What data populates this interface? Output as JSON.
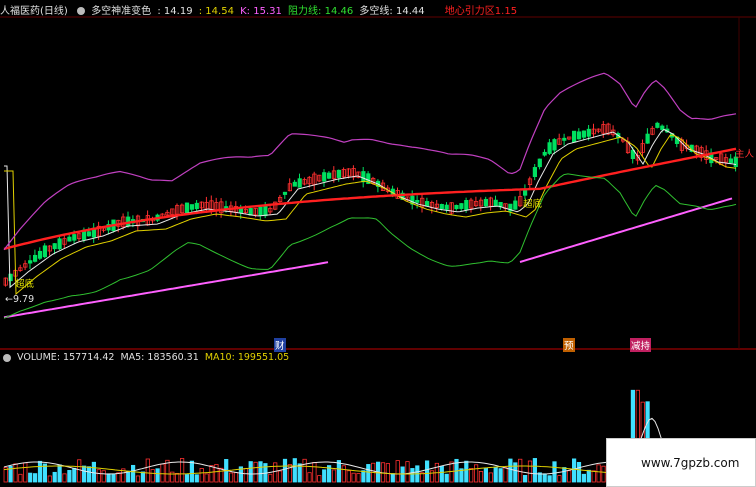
{
  "header": {
    "stock": "人福医药(日线)",
    "indicator_name": "多空神准变色",
    "v1": ": 14.19",
    "v2": ": 14.54",
    "k_label": "K: 15.31",
    "zl_label": "阻力线: 14.46",
    "dk_label": "多空线: 14.44",
    "gravity_label": "地心引力区1.15"
  },
  "volume_header": {
    "label": "VOLUME: 157714.42",
    "ma5": "MA5: 183560.31",
    "ma10": "MA10: 199551.05"
  },
  "markers": {
    "cai": "财",
    "yu": "预",
    "jiyu": "减持",
    "zhuli": "主人",
    "low_price": "←9.79",
    "buy1": "超底",
    "buy2": "超底",
    "buy3": "超底"
  },
  "watermark": {
    "text": "www.7gpzb.com"
  },
  "colors": {
    "up": "#ff3030",
    "down": "#00e060",
    "ma_white": "#e8e8e8",
    "ma_yellow": "#e0d000",
    "magenta": "#ff60ff",
    "purple": "#c040c0",
    "green_line": "#30c030",
    "vol_up": "#ff3030",
    "vol_down": "#40e0ff"
  },
  "chart_data": {
    "type": "candlestick",
    "price_range": [
      8.8,
      17.2
    ],
    "low_price_marker": 9.79
  }
}
